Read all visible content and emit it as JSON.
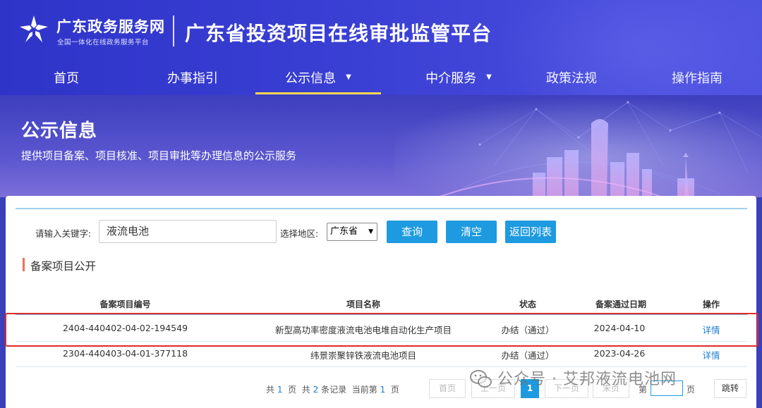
{
  "header": {
    "brand_name": "广东政务服务网",
    "brand_sub": "全国一体化在线政务服务平台",
    "platform_title": "广东省投资项目在线审批监管平台"
  },
  "nav": {
    "items": [
      {
        "label": "首页"
      },
      {
        "label": "办事指引"
      },
      {
        "label": "公示信息",
        "active": true,
        "has_dropdown": true
      },
      {
        "label": "中介服务",
        "has_dropdown": true
      },
      {
        "label": "政策法规"
      },
      {
        "label": "操作指南"
      }
    ]
  },
  "banner": {
    "title": "公示信息",
    "description": "提供项目备案、项目核准、项目审批等办理信息的公示服务"
  },
  "search": {
    "keyword_label": "请输入关键字:",
    "keyword_value": "液流电池",
    "region_label": "选择地区:",
    "region_value": "广东省",
    "query_button": "查询",
    "clear_button": "清空",
    "back_button": "返回列表"
  },
  "section": {
    "title": "备案项目公开"
  },
  "table": {
    "headers": [
      "备案项目编号",
      "项目名称",
      "状态",
      "备案通过日期",
      "操作"
    ],
    "rows": [
      {
        "code": "2404-440402-04-02-194549",
        "name": "新型高功率密度液流电池电堆自动化生产项目",
        "status": "办结（通过）",
        "date": "2024-04-10",
        "action": "详情"
      },
      {
        "code": "2304-440403-04-01-377118",
        "name": "纬景崇聚锌铁液流电池项目",
        "status": "办结（通过）",
        "date": "2023-04-26",
        "action": "详情"
      }
    ]
  },
  "pagination": {
    "total_prefix": "共",
    "total_pages": "1",
    "pages_suffix": "页",
    "total_prefix2": "共",
    "total_records": "2",
    "records_suffix": "条记录",
    "current_prefix": "当前第",
    "current_page": "1",
    "current_suffix": "页",
    "first": "首页",
    "prev": "上一页",
    "page_button": "1",
    "next": "下一页",
    "last": "末页",
    "goto_prefix": "第",
    "goto_suffix": "页",
    "jump": "跳转"
  },
  "watermark": {
    "text": "公众号 · 艾邦液流电池网"
  },
  "colors": {
    "header_blue": "#3a3fd4",
    "button_blue": "#1e9be0",
    "active_underline": "#ffd94a",
    "highlight_red": "#e02a2a",
    "section_accent": "#f26e5a",
    "link_blue": "#1c7fd1"
  },
  "icons": {
    "logo": "guangdong-gov-star-logo-icon",
    "dropdown": "caret-down-icon",
    "watermark": "wechat-icon"
  }
}
